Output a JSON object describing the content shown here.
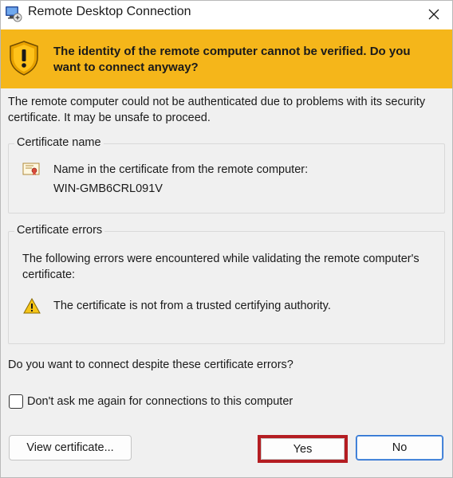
{
  "window": {
    "title": "Remote Desktop Connection",
    "app_icon": "remote-desktop-icon",
    "close_icon": "close-icon"
  },
  "banner": {
    "icon": "warning-shield-icon",
    "text": "The identity of the remote computer cannot be verified. Do you want to connect anyway?",
    "color": "#f5b61a"
  },
  "message": "The remote computer could not be authenticated due to problems with its security certificate. It may be unsafe to proceed.",
  "certificate_group": {
    "legend": "Certificate name",
    "icon": "certificate-icon",
    "label": "Name in the certificate from the remote computer:",
    "value": "WIN-GMB6CRL091V"
  },
  "errors_group": {
    "legend": "Certificate errors",
    "intro": "The following errors were encountered while validating the remote computer's certificate:",
    "items": [
      {
        "icon": "warning-icon",
        "text": "The certificate is not from a trusted certifying authority."
      }
    ]
  },
  "question": "Do you want to connect despite these certificate errors?",
  "checkbox": {
    "label": "Don't ask me again for connections to this computer",
    "checked": false
  },
  "buttons": {
    "view_certificate": "View certificate...",
    "yes": "Yes",
    "no": "No"
  },
  "highlight_color": "#b41d22"
}
